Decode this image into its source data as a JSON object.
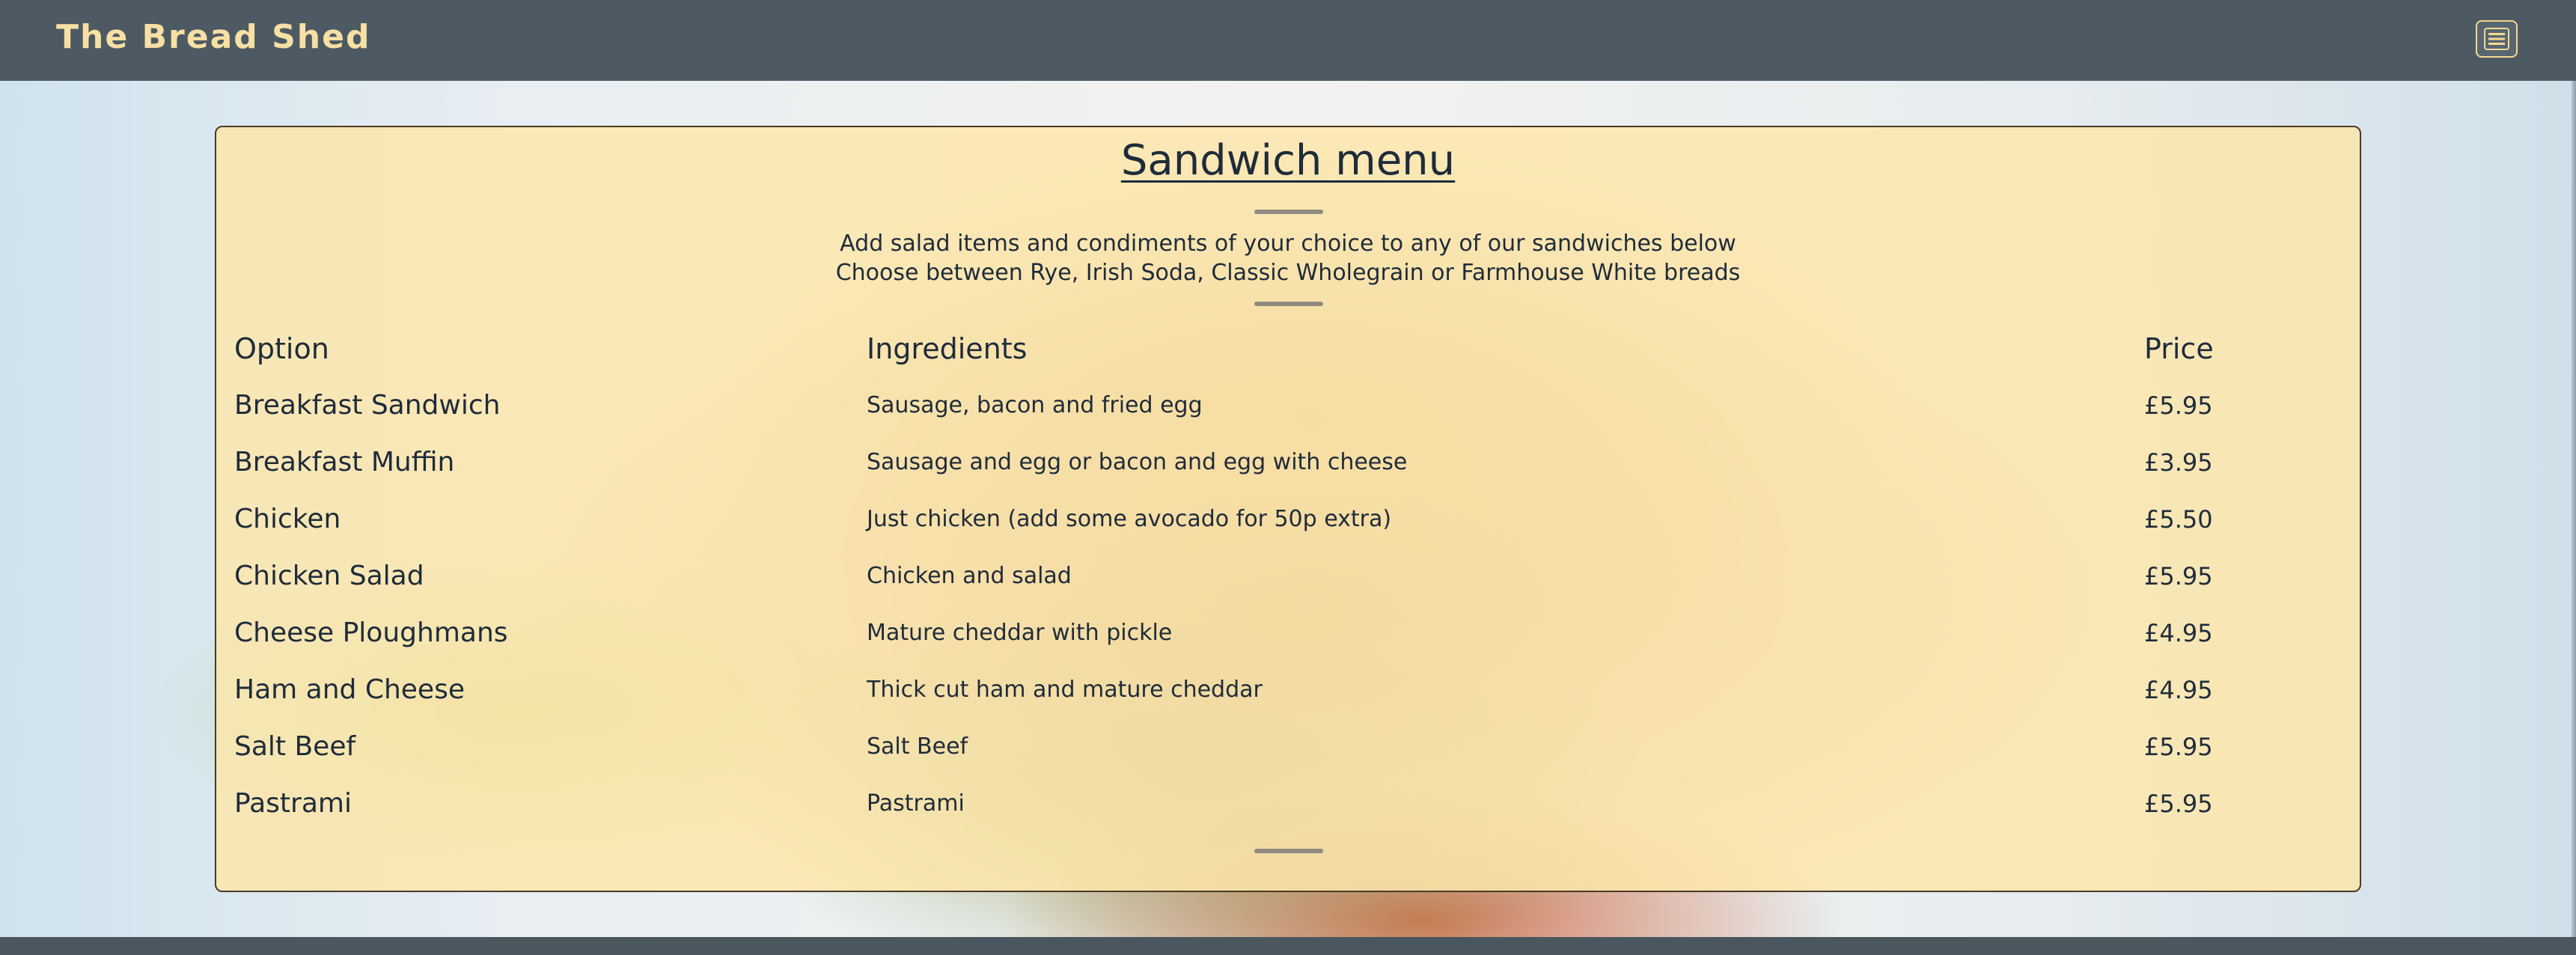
{
  "navbar": {
    "brand": "The Bread Shed",
    "menu_icon": "hamburger-menu-icon",
    "brand_color": "#f7e0a3",
    "background_color": "#4d5a63"
  },
  "menu": {
    "title": "Sandwich menu",
    "subtitle_line1": "Add salad items and condiments of your choice to any of our sandwiches below",
    "subtitle_line2": "Choose between Rye, Irish Soda, Classic Wholegrain or Farmhouse White breads",
    "columns": {
      "option": "Option",
      "ingredients": "Ingredients",
      "price": "Price"
    },
    "items": [
      {
        "option": "Breakfast Sandwich",
        "ingredients": "Sausage, bacon and fried egg",
        "price": "£5.95"
      },
      {
        "option": "Breakfast Muffin",
        "ingredients": "Sausage and egg or bacon and egg with cheese",
        "price": "£3.95"
      },
      {
        "option": "Chicken",
        "ingredients": "Just chicken (add some avocado for 50p extra)",
        "price": "£5.50"
      },
      {
        "option": "Chicken Salad",
        "ingredients": "Chicken and salad",
        "price": "£5.95"
      },
      {
        "option": "Cheese Ploughmans",
        "ingredients": "Mature cheddar with pickle",
        "price": "£4.95"
      },
      {
        "option": "Ham and Cheese",
        "ingredients": "Thick cut ham and mature cheddar",
        "price": "£4.95"
      },
      {
        "option": "Salt Beef",
        "ingredients": "Salt Beef",
        "price": "£5.95"
      },
      {
        "option": "Pastrami",
        "ingredients": "Pastrami",
        "price": "£5.95"
      }
    ]
  }
}
